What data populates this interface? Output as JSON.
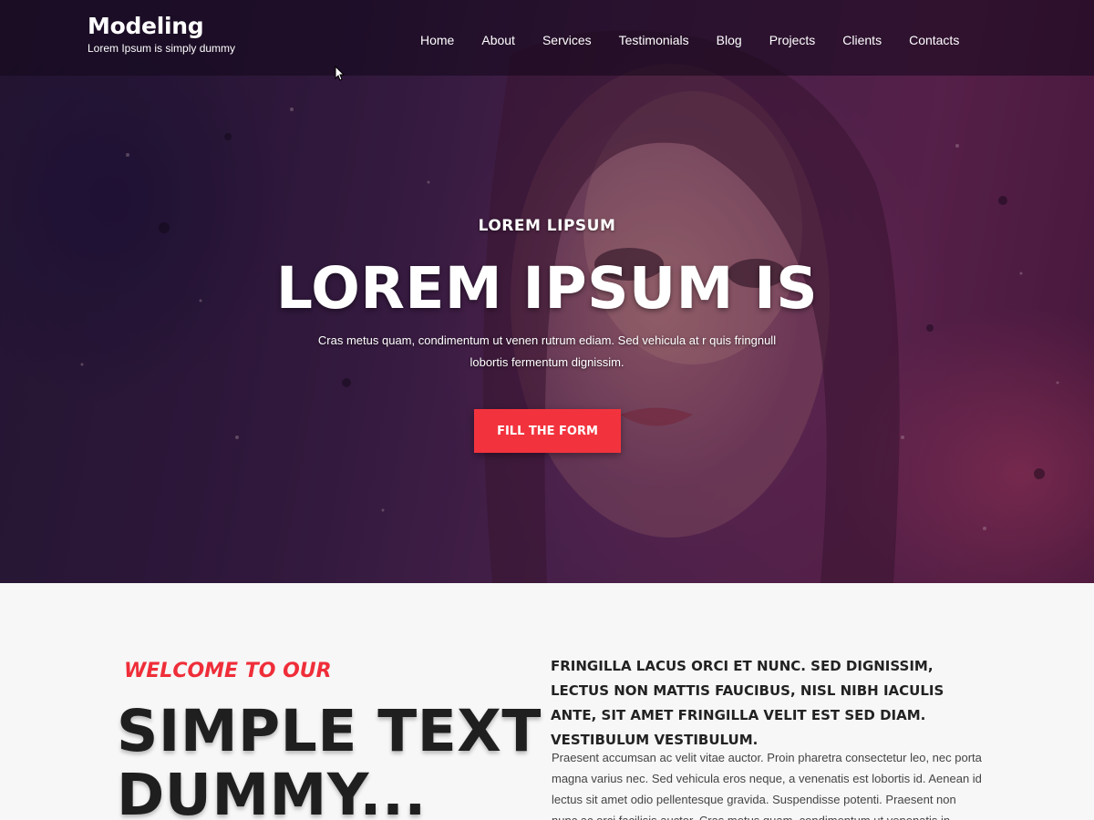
{
  "header": {
    "brand_title": "Modeling",
    "brand_tagline": "Lorem Ipsum is simply dummy",
    "nav": [
      {
        "label": "Home"
      },
      {
        "label": "About"
      },
      {
        "label": "Services"
      },
      {
        "label": "Testimonials"
      },
      {
        "label": "Blog"
      },
      {
        "label": "Projects"
      },
      {
        "label": "Clients"
      },
      {
        "label": "Contacts"
      }
    ]
  },
  "hero": {
    "kicker": "LOREM LIPSUM",
    "headline": "LOREM IPSUM IS",
    "description": "Cras metus quam, condimentum ut venen rutrum ediam. Sed vehicula at r quis fringnull lobortis fermentum dignissim.",
    "button_label": "FILL THE FORM"
  },
  "about": {
    "welcome": "WELCOME TO OUR",
    "title": "SIMPLE TEXT DUMMY...",
    "lead": "FRINGILLA LACUS ORCI ET NUNC. SED DIGNISSIM, LECTUS NON MATTIS FAUCIBUS, NISL NIBH IACULIS ANTE, SIT AMET FRINGILLA VELIT EST SED DIAM. VESTIBULUM VESTIBULUM.",
    "body": "Praesent accumsan ac velit vitae auctor. Proin pharetra consectetur leo, nec porta magna varius nec. Sed vehicula eros neque, a venenatis est lobortis id. Aenean id lectus sit amet odio pellentesque gravida. Suspendisse potenti. Praesent non nunc ac orci facilisis auctor. Cras metus quam, condimentum ut venenatis in, rutrum eget"
  },
  "colors": {
    "accent": "#f2333d",
    "welcome": "#ef2e39",
    "dark_text": "#1f1f1f"
  }
}
